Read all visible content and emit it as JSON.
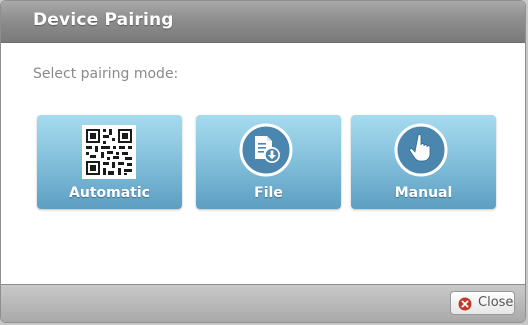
{
  "dialog": {
    "title": "Device Pairing"
  },
  "content": {
    "prompt": "Select pairing mode:",
    "modes": [
      {
        "label": "Automatic",
        "icon": "qr-code-icon"
      },
      {
        "label": "File",
        "icon": "file-download-icon"
      },
      {
        "label": "Manual",
        "icon": "hand-pointer-icon"
      }
    ]
  },
  "footer": {
    "close_label": "Close",
    "close_icon": "close-icon"
  },
  "colors": {
    "titlebar": "#8e8e8e",
    "mode_button_top": "#a6dbee",
    "mode_button_bottom": "#5d9ec2",
    "icon_blue": "#3e7ba3",
    "close_icon_red": "#c0392b"
  }
}
